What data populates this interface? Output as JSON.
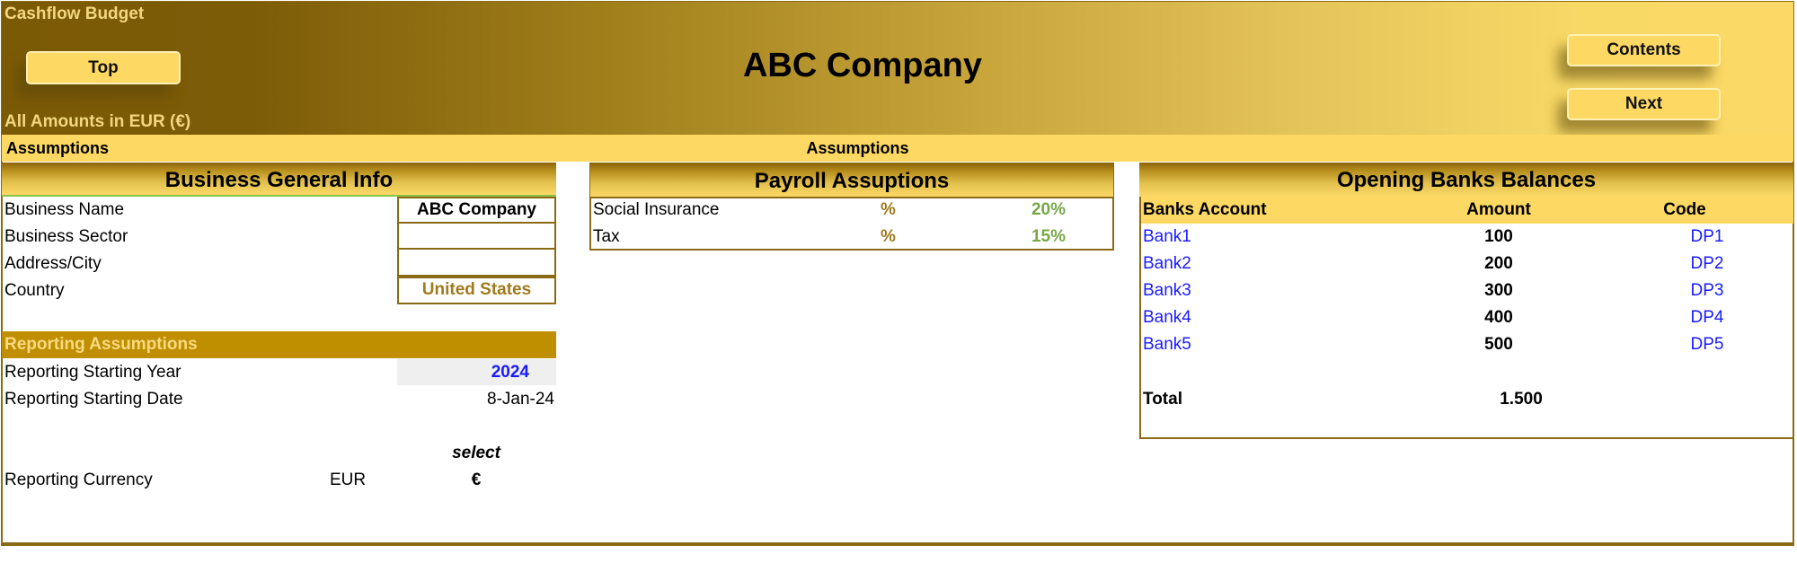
{
  "header": {
    "app_title": "Cashflow Budget",
    "company_name": "ABC Company",
    "amounts_note": "All Amounts in  EUR (€)",
    "buttons": {
      "top": "Top",
      "contents": "Contents",
      "next": "Next"
    }
  },
  "strip": {
    "left_label": "Assumptions",
    "center_label": "Assumptions"
  },
  "business_info": {
    "title": "Business General Info",
    "rows": [
      {
        "label": "Business Name",
        "value": "ABC Company"
      },
      {
        "label": "Business Sector",
        "value": ""
      },
      {
        "label": "Address/City",
        "value": ""
      },
      {
        "label": "Country",
        "value": "United States"
      }
    ]
  },
  "reporting": {
    "title": "Reporting Assumptions",
    "starting_year_label": "Reporting Starting Year",
    "starting_year_value": "2024",
    "starting_date_label": "Reporting Starting Date",
    "starting_date_value": "8-Jan-24",
    "select_label": "select",
    "currency_label": "Reporting Currency",
    "currency_code": "EUR",
    "currency_symbol": "€"
  },
  "payroll": {
    "title": "Payroll Assuptions",
    "rows": [
      {
        "label": "Social Insurance",
        "unit": "%",
        "value": "20%"
      },
      {
        "label": "Tax",
        "unit": "%",
        "value": "15%"
      }
    ]
  },
  "banks": {
    "title": "Opening Banks Balances",
    "columns": [
      "Banks Account",
      "Amount",
      "Code"
    ],
    "rows": [
      {
        "account": "Bank1",
        "amount": "100",
        "code": "DP1"
      },
      {
        "account": "Bank2",
        "amount": "200",
        "code": "DP2"
      },
      {
        "account": "Bank3",
        "amount": "300",
        "code": "DP3"
      },
      {
        "account": "Bank4",
        "amount": "400",
        "code": "DP4"
      },
      {
        "account": "Bank5",
        "amount": "500",
        "code": "DP5"
      }
    ],
    "total_label": "Total",
    "total_value": "1.500"
  },
  "colors": {
    "banner_dark": "#7b5a06",
    "banner_light": "#fcd966",
    "accent_gold": "#bf8f00",
    "border": "#8a6a14",
    "input_blue": "#1a1aff",
    "percent_green": "#76a844"
  }
}
